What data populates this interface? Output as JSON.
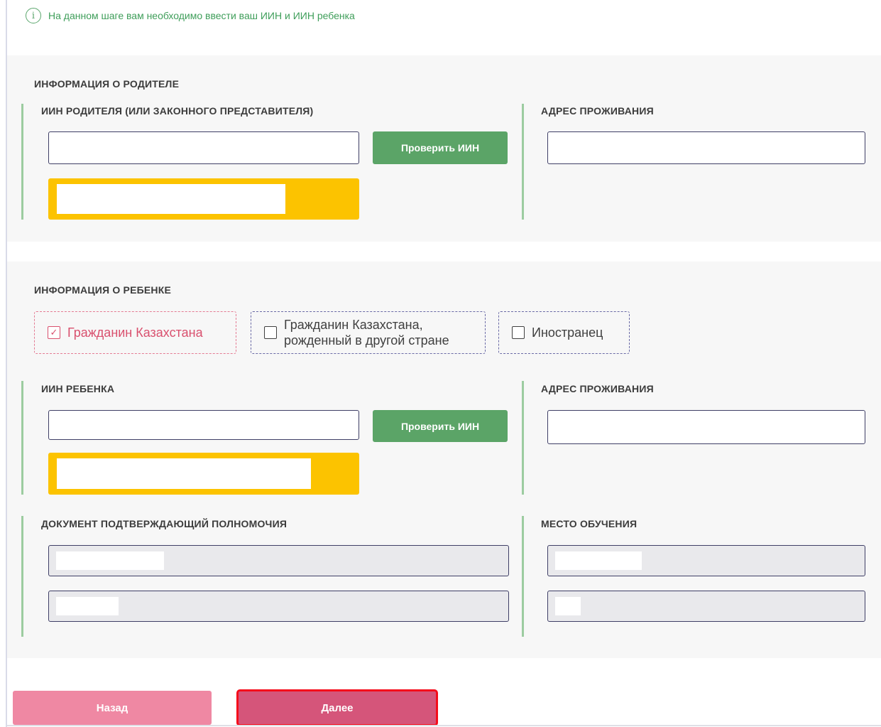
{
  "notice": {
    "icon": "info-icon",
    "text": "На данном шаге вам необходимо ввести ваш ИИН и ИИН ребенка"
  },
  "parent": {
    "section_title": "ИНФОРМАЦИЯ О РОДИТЕЛЕ",
    "iin_label": "ИИН РОДИТЕЛЯ (ИЛИ ЗАКОННОГО ПРЕДСТАВИТЕЛЯ)",
    "iin_value": "",
    "check_button": "Проверить ИИН",
    "address_label": "АДРЕС ПРОЖИВАНИЯ",
    "address_value": ""
  },
  "child": {
    "section_title": "ИНФОРМАЦИЯ О РЕБЕНКЕ",
    "citizenship_options": [
      {
        "label": "Гражданин Казахстана",
        "checked": true
      },
      {
        "label": "Гражданин Казахстана, рожденный в другой стране",
        "checked": false
      },
      {
        "label": "Иностранец",
        "checked": false
      }
    ],
    "iin_label": "ИИН РЕБЕНКА",
    "iin_value": "",
    "check_button": "Проверить ИИН",
    "address_label": "АДРЕС ПРОЖИВАНИЯ",
    "address_value": "",
    "document_label": "ДОКУМЕНТ ПОДТВЕРЖДАЮЩИЙ ПОЛНОМОЧИЯ",
    "study_place_label": "МЕСТО ОБУЧЕНИЯ"
  },
  "footer": {
    "back_label": "Назад",
    "next_label": "Далее"
  },
  "colors": {
    "accent_green": "#5ba467",
    "warning_yellow": "#fcc300",
    "back_pink": "#ef88a3",
    "next_pink": "#d5557a",
    "highlight_red": "#f50c1b"
  }
}
